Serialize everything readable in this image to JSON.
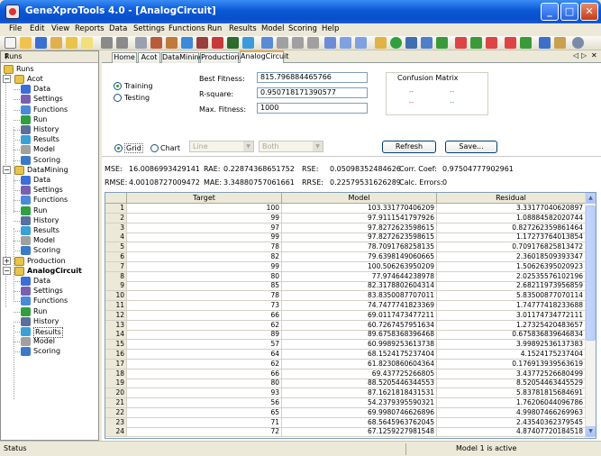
{
  "window": {
    "title": "GeneXproTools 4.0 - [AnalogCircuit]"
  },
  "menu": [
    "File",
    "Edit",
    "View",
    "Reports",
    "Data",
    "Settings",
    "Functions",
    "Run",
    "Results",
    "Model",
    "Scoring",
    "Help"
  ],
  "runs_panel": {
    "title": "Runs",
    "pin": "\u0004",
    "tree": {
      "root": "Runs",
      "projects": [
        {
          "name": "Acot",
          "expanded": true,
          "children": [
            "Data",
            "Settings",
            "Functions",
            "Run",
            "History",
            "Results",
            "Model",
            "Scoring"
          ]
        },
        {
          "name": "DataMining",
          "expanded": true,
          "children": [
            "Data",
            "Settings",
            "Functions",
            "Run",
            "History",
            "Results",
            "Model",
            "Scoring"
          ]
        },
        {
          "name": "Production",
          "expanded": false,
          "children": []
        },
        {
          "name": "AnalogCircuit",
          "expanded": true,
          "bold": true,
          "selected_child": "Results",
          "children": [
            "Data",
            "Settings",
            "Functions",
            "Run",
            "History",
            "Results",
            "Model",
            "Scoring"
          ]
        }
      ]
    }
  },
  "tabs": [
    "Home",
    "Acot",
    "DataMining",
    "Production",
    "AnalogCircuit"
  ],
  "active_tab": "AnalogCircuit",
  "tab_controls": {
    "left": "◁",
    "right": "▷",
    "close": "✕"
  },
  "results": {
    "mode": {
      "training": "Training",
      "testing": "Testing",
      "selected": "Training"
    },
    "best_fitness_label": "Best Fitness:",
    "best_fitness": "815.796884465766",
    "rsquare_label": "R-square:",
    "rsquare": "0.950718171390577",
    "max_fitness_label": "Max. Fitness:",
    "max_fitness": "1000",
    "confusion_matrix": {
      "title": "Confusion Matrix",
      "values": [
        "--",
        "--",
        "--",
        "--"
      ],
      "colors": [
        "#3a8a3a",
        "#d23b3b",
        "#d23b3b",
        "#3a8a3a"
      ]
    },
    "view": {
      "grid": "Grid",
      "chart": "Chart",
      "selected": "Grid",
      "chart_type": "Line",
      "series": "Both"
    },
    "refresh": "Refresh",
    "save": "Save...",
    "stats": {
      "mse_label": "MSE:",
      "mse": "16.0086993429141",
      "rmse_label": "RMSE:",
      "rmse": "4.00108727009472",
      "rae_label": "RAE:",
      "rae": "0.22874368651752",
      "mae_label": "MAE:",
      "mae": "3.34880757061661",
      "rse_label": "RSE:",
      "rse": "0.05098352484626",
      "rrse_label": "RRSE:",
      "rrse": "0.22579531626289",
      "corr_label": "Corr. Coef:",
      "corr": "0.97504777902961",
      "calc_label": "Calc. Errors:",
      "calc": "0"
    },
    "grid": {
      "headers": [
        "",
        "Target",
        "Model",
        "Residual"
      ],
      "rows": [
        [
          "1",
          "100",
          "103.331770406209",
          "3.33177040620897"
        ],
        [
          "2",
          "99",
          "97.9111541797926",
          "1.08884582020744"
        ],
        [
          "3",
          "97",
          "97.8272623598615",
          "0.827262359861464"
        ],
        [
          "4",
          "99",
          "97.8272623598615",
          "1.17273764013854"
        ],
        [
          "5",
          "78",
          "78.7091768258135",
          "0.709176825813472"
        ],
        [
          "6",
          "82",
          "79.6398149060665",
          "2.36018509393347"
        ],
        [
          "7",
          "99",
          "100.506263950209",
          "1.50626395020923"
        ],
        [
          "8",
          "80",
          "77.974644238978",
          "2.02535576102196"
        ],
        [
          "9",
          "85",
          "82.3178802604314",
          "2.68211973956859"
        ],
        [
          "10",
          "78",
          "83.8350087707011",
          "5.83500877070114"
        ],
        [
          "11",
          "73",
          "74.7477741823369",
          "1.74777418233688"
        ],
        [
          "12",
          "66",
          "69.0117473477211",
          "3.01174734772111"
        ],
        [
          "13",
          "62",
          "60.7267457951634",
          "1.27325420483657"
        ],
        [
          "14",
          "89",
          "89.6758368396468",
          "0.675836839646834"
        ],
        [
          "15",
          "57",
          "60.9989253613738",
          "3.99892536137383"
        ],
        [
          "16",
          "64",
          "68.1524175237404",
          "4.1524175237404"
        ],
        [
          "17",
          "62",
          "61.8230860604364",
          "0.176913939563619"
        ],
        [
          "18",
          "66",
          "69.437725266805",
          "3.43772526680499"
        ],
        [
          "19",
          "80",
          "88.5205446344553",
          "8.52054463445529"
        ],
        [
          "20",
          "93",
          "87.1621818431531",
          "5.83781815684691"
        ],
        [
          "21",
          "56",
          "54.2379395590321",
          "1.76206044096786"
        ],
        [
          "22",
          "65",
          "69.9980746626896",
          "4.99807466269963"
        ],
        [
          "23",
          "71",
          "68.5645963762045",
          "2.43540362379545"
        ],
        [
          "24",
          "72",
          "67.1259227981548",
          "4.87407720184518"
        ]
      ]
    }
  },
  "statusbar": {
    "left": "Status",
    "right": "Model 1 is active"
  }
}
